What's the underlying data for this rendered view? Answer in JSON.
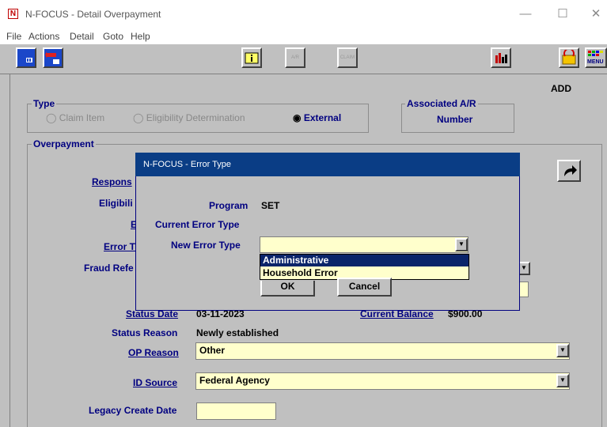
{
  "window": {
    "title": "N-FOCUS - Detail Overpayment",
    "logo": "N",
    "controls": {
      "minimize": "—",
      "maximize": "☐",
      "close": "✕"
    }
  },
  "menu": [
    "File",
    "Actions",
    "Detail",
    "Goto",
    "Help"
  ],
  "toolbar": {
    "buttons": [
      {
        "name": "save-icon",
        "text": ".Ⅲ"
      },
      {
        "name": "exit-icon",
        "text": ""
      },
      {
        "name": "info-icon",
        "text": "i"
      },
      {
        "name": "ar-icon",
        "text": "A/R"
      },
      {
        "name": "claim-icon",
        "text": "CLAIM"
      },
      {
        "name": "chart-icon",
        "text": ""
      },
      {
        "name": "refresh-icon",
        "text": ""
      },
      {
        "name": "menu-icon",
        "text": "MENU"
      }
    ]
  },
  "mode": "ADD",
  "type_group": {
    "title": "Type",
    "options": [
      {
        "label": "Claim Item",
        "selected": false
      },
      {
        "label": "Eligibility Determination",
        "selected": false
      },
      {
        "label": "External",
        "selected": true
      }
    ]
  },
  "associated_ar": {
    "title": "Associated A/R",
    "label": "Number"
  },
  "overpayment": {
    "title": "Overpayment",
    "responsible": "Respons",
    "eligibility": "Eligibili",
    "e_label": "E",
    "error_type": "Error T",
    "fraud_referral": "Fraud Refe",
    "status_date_label": "Status Date",
    "status_date_value": "03-11-2023",
    "current_balance_label": "Current Balance",
    "current_balance_value": "$900.00",
    "status_reason_label": "Status Reason",
    "status_reason_value": "Newly established",
    "op_reason_label": "OP Reason",
    "op_reason_value": "Other",
    "id_source_label": "ID Source",
    "id_source_value": "Federal Agency",
    "legacy_create_label": "Legacy Create Date",
    "legacy_create_value": ""
  },
  "dialog": {
    "title": "N-FOCUS - Error Type",
    "program_label": "Program",
    "program_value": "SET",
    "current_error_label": "Current Error Type",
    "new_error_label": "New Error Type",
    "new_error_value": "",
    "options": [
      "Administrative",
      "Household Error"
    ],
    "ok_label": "OK",
    "cancel_label": "Cancel"
  },
  "colors": {
    "label": "#000080",
    "field": "#ffffcc",
    "dialog_title": "#0a3d85",
    "selection": "#0a246a"
  }
}
